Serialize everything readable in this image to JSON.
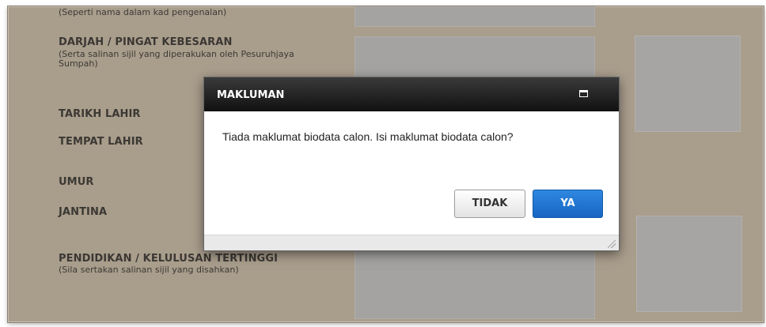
{
  "form": {
    "ic_name_hint": "(Seperti nama dalam kad pengenalan)",
    "award_label": "DARJAH / PINGAT KEBESARAN",
    "award_hint": "(Serta salinan sijil yang diperakukan oleh Pesuruhjaya Sumpah)",
    "dob_label": "TARIKH LAHIR",
    "pob_label": "TEMPAT LAHIR",
    "age_label": "UMUR",
    "gender_label": "JANTINA",
    "education_label": "PENDIDIKAN / KELULUSAN TERTINGGI",
    "education_hint": "(Sila sertakan salinan sijil yang disahkan)"
  },
  "dialog": {
    "title": "MAKLUMAN",
    "message": "Tiada maklumat biodata calon. Isi maklumat biodata calon?",
    "no_label": "TIDAK",
    "yes_label": "YA"
  },
  "colors": {
    "background_overlay": "#a99d8c",
    "dialog_header": "#1a1a1a",
    "primary_button": "#1f74d2"
  }
}
